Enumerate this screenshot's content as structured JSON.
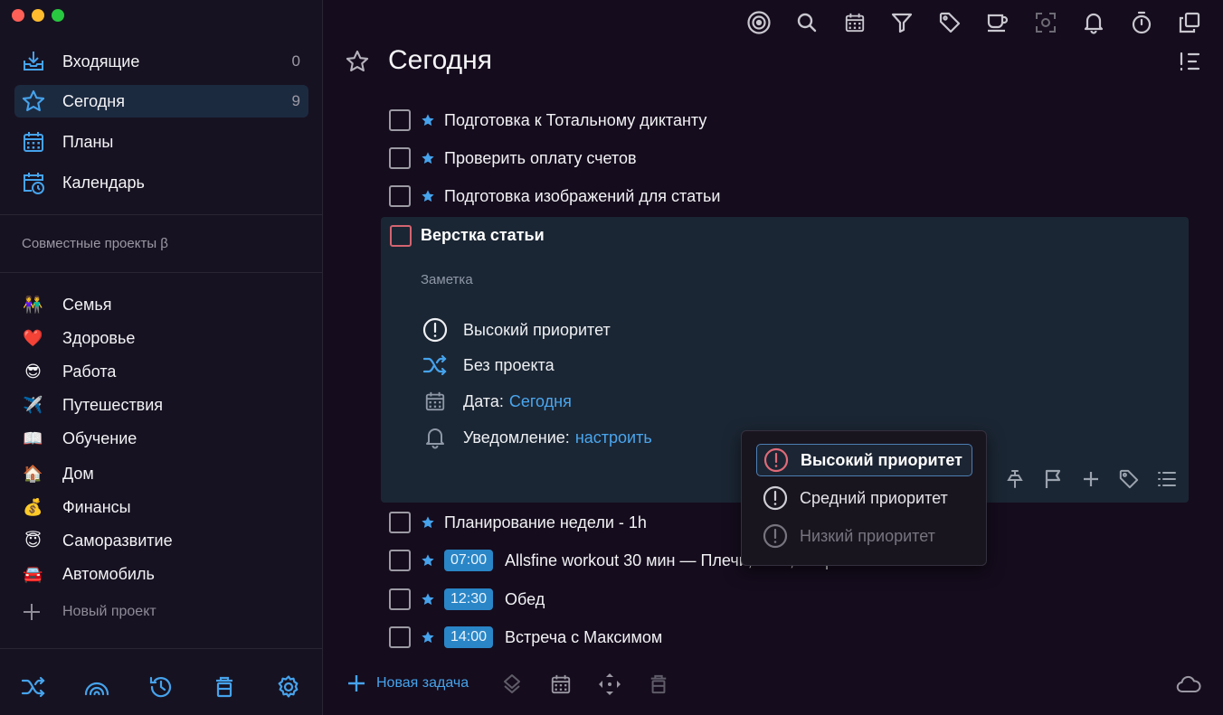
{
  "sidebar": {
    "nav": [
      {
        "label": "Входящие",
        "count": "0",
        "icon": "inbox-tray-icon"
      },
      {
        "label": "Сегодня",
        "count": "9",
        "icon": "star-icon"
      },
      {
        "label": "Планы",
        "count": "",
        "icon": "calendar-grid-icon"
      },
      {
        "label": "Календарь",
        "count": "",
        "icon": "calendar-clock-icon"
      }
    ],
    "shared_title": "Совместные проекты β",
    "projects": [
      {
        "label": "Семья",
        "emoji": "👫"
      },
      {
        "label": "Здоровье",
        "emoji": "❤️"
      },
      {
        "label": "Работа",
        "emoji": "😎"
      },
      {
        "label": "Путешествия",
        "emoji": "✈️"
      },
      {
        "label": "Обучение",
        "emoji": "📖"
      },
      {
        "label": "Дом",
        "emoji": "🏠"
      },
      {
        "label": "Финансы",
        "emoji": "💰"
      },
      {
        "label": "Саморазвитие",
        "emoji": "😇"
      },
      {
        "label": "Автомобиль",
        "emoji": "🚘"
      }
    ],
    "new_project": "Новый проект"
  },
  "main": {
    "title": "Сегодня",
    "tasks_top": [
      {
        "title": "Подготовка к Тотальному диктанту"
      },
      {
        "title": "Проверить оплату счетов"
      },
      {
        "title": "Подготовка изображений для статьи"
      }
    ],
    "expanded_task": {
      "title": "Верстка статьи",
      "note_placeholder": "Заметка",
      "priority": "Высокий приоритет",
      "project": "Без проекта",
      "date_label": "Дата:",
      "date_value": "Сегодня",
      "reminder_label": "Уведомление:",
      "reminder_value": "настроить"
    },
    "tasks_bottom": [
      {
        "title": "Планирование недели - 1h",
        "time": ""
      },
      {
        "title": "Allsfine workout 30 мин — Плечи, Шея, Лицо",
        "time": "07:00"
      },
      {
        "title": "Обед",
        "time": "12:30"
      },
      {
        "title": "Встреча с Максимом",
        "time": "14:00"
      }
    ],
    "new_task": "Новая задача"
  },
  "priority_menu": {
    "items": [
      {
        "label": "Высокий приоритет",
        "selected": true
      },
      {
        "label": "Средний приоритет",
        "selected": false
      },
      {
        "label": "Низкий приоритет",
        "selected": false
      }
    ]
  },
  "colors": {
    "accent": "#4aa6ee",
    "sidebar_active": "#1c2a40",
    "high_priority": "#d36470",
    "time_badge": "#2a86c7"
  }
}
